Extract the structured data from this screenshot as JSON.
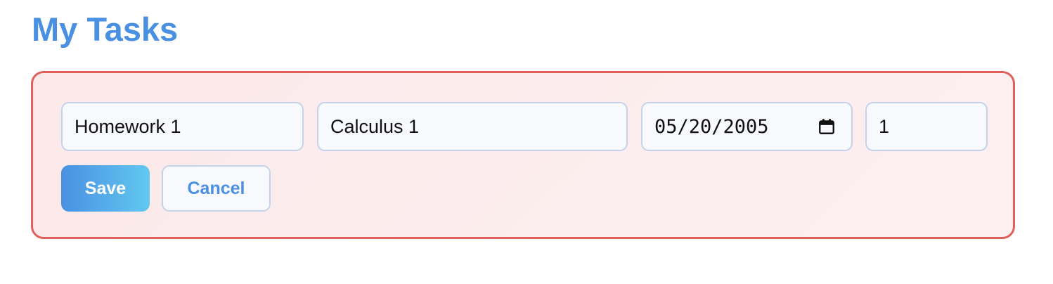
{
  "page": {
    "title": "My Tasks"
  },
  "edit_form": {
    "task_name": "Homework 1",
    "course": "Calculus 1",
    "due_date": "05/20/2005",
    "priority": "1",
    "save_label": "Save",
    "cancel_label": "Cancel",
    "date_icon": "calendar-icon"
  },
  "colors": {
    "accent": "#4a90e2",
    "panel_border": "#e2605b",
    "panel_background": "#fcecec"
  }
}
